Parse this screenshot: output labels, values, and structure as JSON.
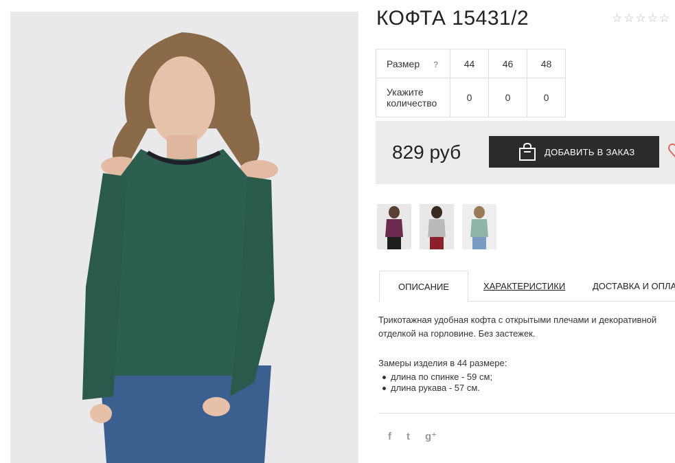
{
  "product": {
    "title": "КОФТА 15431/2",
    "rating_stars": [
      "☆",
      "☆",
      "☆",
      "☆",
      "☆"
    ]
  },
  "size_table": {
    "size_label": "Размер",
    "help_icon": "?",
    "qty_label": "Укажите количество",
    "sizes": [
      "44",
      "46",
      "48"
    ],
    "quantities": [
      "0",
      "0",
      "0"
    ]
  },
  "purchase": {
    "price": "829 руб",
    "order_button": "ДОБАВИТЬ В ЗАКАЗ"
  },
  "tabs": [
    "ОПИСАНИЕ",
    "ХАРАКТЕРИСТИКИ",
    "ДОСТАВКА И ОПЛАТА"
  ],
  "description": {
    "text": "Трикотажная удобная кофта с открытыми плечами и декоративной отделкой на горловине. Без застежек.",
    "measure_title": "Замеры изделия в 44 размере:",
    "measures": [
      "длина по спинке - 59 см;",
      "длина рукава - 57 см."
    ]
  },
  "social": [
    "f",
    "t",
    "g⁺"
  ],
  "colors": {
    "sweater": "#2c5f4f",
    "button_bg": "#2b2b2b",
    "price_bar_bg": "#ececec",
    "thumb_colors": [
      "#6b2a4e",
      "#b9b9b9",
      "#8fb5a8"
    ]
  }
}
